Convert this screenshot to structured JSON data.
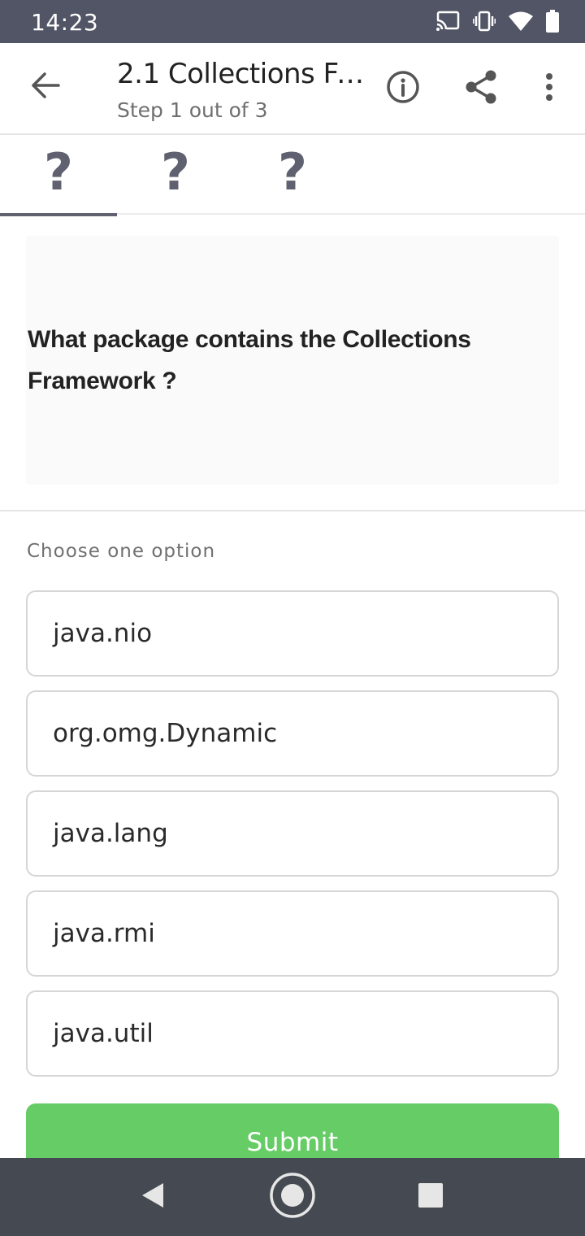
{
  "status_bar": {
    "time": "14:23",
    "icons": [
      "cast-icon",
      "vibrate-icon",
      "wifi-icon",
      "battery-icon"
    ]
  },
  "app_bar": {
    "title": "2.1 Collections Fr...",
    "subtitle": "Step 1 out of 3",
    "icons": [
      "back-arrow-icon",
      "info-icon",
      "share-icon",
      "more-vert-icon"
    ]
  },
  "steps": [
    {
      "label": "?",
      "active": true
    },
    {
      "label": "?",
      "active": false
    },
    {
      "label": "?",
      "active": false
    }
  ],
  "question": {
    "text": "What package contains the Collections Framework ?"
  },
  "quiz": {
    "choose_label": "Choose one option",
    "options": [
      "java.nio",
      "org.omg.Dynamic",
      "java.lang",
      "java.rmi",
      "java.util"
    ],
    "submit_label": "Submit"
  },
  "colors": {
    "status_bar": "#525566",
    "submit": "#66cc66",
    "nav_bar": "#454a52",
    "step_indicator": "#5f6070"
  },
  "nav_bar": {
    "icons": [
      "nav-back-icon",
      "nav-home-icon",
      "nav-recents-icon"
    ]
  }
}
